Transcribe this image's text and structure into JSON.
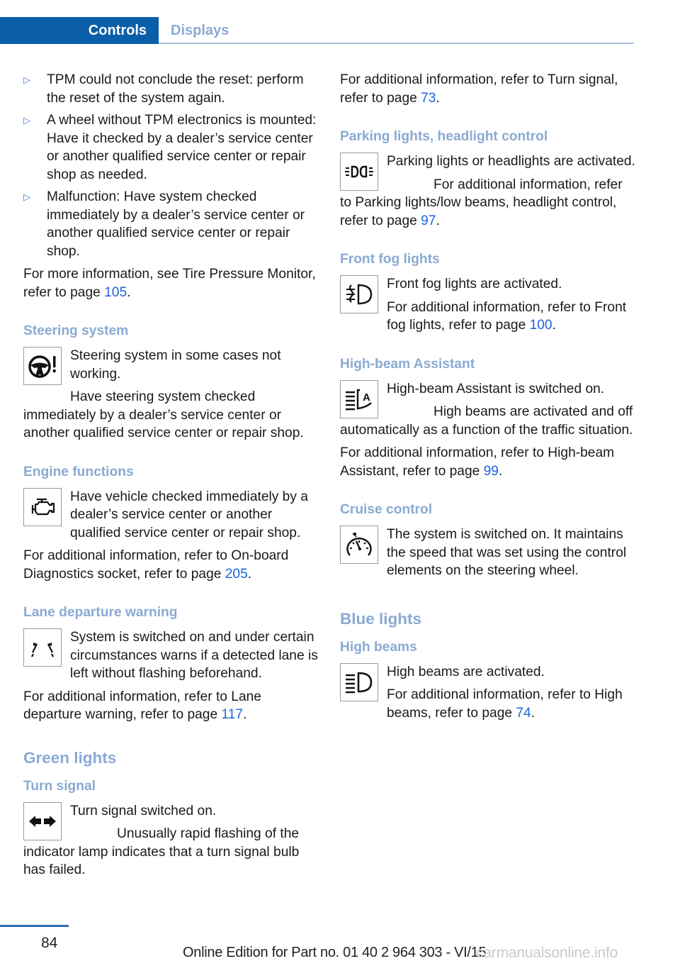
{
  "header": {
    "active_tab": "Controls",
    "inactive_tab": "Displays"
  },
  "left": {
    "bullets": [
      "TPM could not conclude the reset: perform the reset of the system again.",
      "A wheel without TPM electronics is mounted: Have it checked by a dealer’s service center or another qualified service center or repair shop as needed.",
      "Malfunction: Have system checked immediately by a dealer’s service center or another qualified service center or repair shop."
    ],
    "tpm_ref": {
      "text": "For more information, see Tire Pressure Monitor, refer to page ",
      "page": "105",
      "end": "."
    },
    "steering": {
      "heading": "Steering system",
      "icon": "steering-warning-icon",
      "text1": "Steering system in some cases not working.",
      "text2": "Have steering system checked immediately by a dealer’s service center or another qualified service center or repair shop."
    },
    "engine": {
      "heading": "Engine functions",
      "icon": "check-engine-icon",
      "text1": "Have vehicle checked immediately by a dealer’s service center or another qualified service center or repair shop.",
      "ref_text": "For additional information, refer to On-board Diagnostics socket, refer to page ",
      "page": "205",
      "end": "."
    },
    "lane": {
      "heading": "Lane departure warning",
      "icon": "lane-departure-icon",
      "text1": "System is switched on and under certain circumstances warns if a detected lane is left without flashing beforehand.",
      "ref_text": "For additional information, refer to Lane departure warning, refer to page ",
      "page": "117",
      "end": "."
    },
    "green_heading": "Green lights",
    "turn": {
      "heading": "Turn signal",
      "icon": "turn-signal-icon",
      "text1": "Turn signal switched on.",
      "text2": "Unusually rapid flashing of the indicator lamp indicates that a turn signal bulb has failed."
    }
  },
  "right": {
    "turn_ref": {
      "text": "For additional information, refer to Turn signal, refer to page ",
      "page": "73",
      "end": "."
    },
    "parking": {
      "heading": "Parking lights, headlight control",
      "icon": "parking-lights-icon",
      "text1": "Parking lights or headlights are activated.",
      "ref_text": "For additional information, refer to Parking lights/low beams, headlight control, refer to page ",
      "page": "97",
      "end": "."
    },
    "fog": {
      "heading": "Front fog lights",
      "icon": "front-fog-lights-icon",
      "text1": "Front fog lights are activated.",
      "ref_text": "For additional information, refer to Front fog lights, refer to page ",
      "page": "100",
      "end": "."
    },
    "hba": {
      "heading": "High-beam Assistant",
      "icon": "high-beam-assistant-icon",
      "text1": "High-beam Assistant is switched on.",
      "text2": "High beams are activated and off automatically as a function of the traffic situation.",
      "ref_text": "For additional information, refer to High-beam Assistant, refer to page ",
      "page": "99",
      "end": "."
    },
    "cruise": {
      "heading": "Cruise control",
      "icon": "cruise-control-icon",
      "text1": "The system is switched on. It maintains the speed that was set using the control elements on the steering wheel."
    },
    "blue_heading": "Blue lights",
    "highbeams": {
      "heading": "High beams",
      "icon": "high-beams-icon",
      "text1": "High beams are activated.",
      "ref_text": "For additional information, refer to High beams, refer to page ",
      "page": "74",
      "end": "."
    }
  },
  "footer": {
    "page_number": "84",
    "edition": "Online Edition for Part no. 01 40 2 964 303 - VI/15",
    "watermark": "carmanualsonline.info"
  }
}
